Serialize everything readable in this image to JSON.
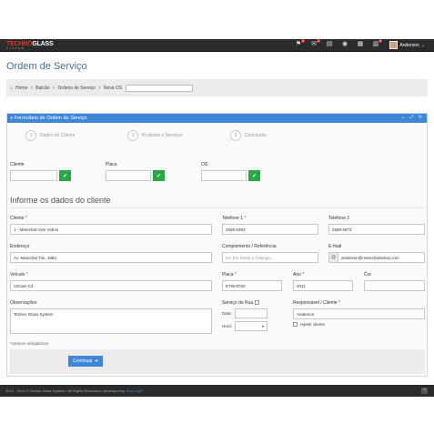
{
  "topbar": {
    "logo_main_a": "TECHNO",
    "logo_main_b": "GLASS",
    "logo_sub": "SYSTEM",
    "icons": [
      {
        "name": "alerts-icon",
        "glyph": "⚑",
        "badge": "2"
      },
      {
        "name": "messages-icon",
        "glyph": "✉",
        "badge": "1"
      },
      {
        "name": "tasks-icon",
        "glyph": "▤",
        "badge": ""
      },
      {
        "name": "globe-icon",
        "glyph": "◉",
        "badge": ""
      },
      {
        "name": "calendar-icon",
        "glyph": "▦",
        "badge": ""
      },
      {
        "name": "orders-icon",
        "glyph": "▥",
        "badge": "3"
      }
    ],
    "user_name": "Anderson"
  },
  "page": {
    "title": "Ordem de Serviço"
  },
  "breadcrumb": {
    "home": "Home",
    "items": [
      "Balcão",
      "Ordens de Serviço",
      "Nova OS"
    ]
  },
  "panel": {
    "title": "Formulário de Ordem de Serviço",
    "controls": "⌄ ⤢ ↻"
  },
  "steps": [
    {
      "num": "1",
      "label": "Dados do Cliente"
    },
    {
      "num": "2",
      "label": "Produtos e Serviços"
    },
    {
      "num": "3",
      "label": "Conclusão"
    }
  ],
  "search": {
    "cliente_label": "Cliente",
    "placa_label": "Placa",
    "os_label": "OS"
  },
  "section_title": "Informe os dados do cliente",
  "form": {
    "cliente": {
      "label": "Cliente",
      "value": "1 - Marechal Auto Vidros"
    },
    "telefone1": {
      "label": "Telefone 1",
      "value": "2585-6393"
    },
    "telefone2": {
      "label": "Telefone 2",
      "value": "2585-6973"
    },
    "endereco": {
      "label": "Endereço",
      "value": "Av. Marechal Tito, 1884"
    },
    "complemento": {
      "label": "Complemento / Referência",
      "placeholder": "Ex: Em frente a Xalunga..."
    },
    "email": {
      "label": "E-mail",
      "value": "anderson@marechalvidros.com"
    },
    "veiculo": {
      "label": "Veículo",
      "value": "Citroen C4"
    },
    "placa": {
      "label": "Placa",
      "value": "ETW-8792"
    },
    "ano": {
      "label": "Ano",
      "value": "2011"
    },
    "cor": {
      "label": "Cor",
      "value": ""
    },
    "observacoes": {
      "label": "Observações",
      "value": "Techno Glass System"
    },
    "servico_rua": {
      "label": "Serviço de Rua",
      "data_label": "Data:",
      "hora_label": "Hora:"
    },
    "responsavel": {
      "label": "Responsável / Cliente",
      "value": "Anderson"
    },
    "repetir": {
      "label": "repetir cliente"
    }
  },
  "footnote": "*campos obrigatórios",
  "continue_label": "Continuar",
  "footer": {
    "text": "2012 - 2014 © Techno Glass System  •  All Rights Reserved  •  developed by",
    "dev": "Blue Light"
  },
  "colors": {
    "accent": "#3e86d8",
    "success": "#28a745",
    "brand_red": "#d9342b",
    "topbar": "#2b2b2b"
  }
}
